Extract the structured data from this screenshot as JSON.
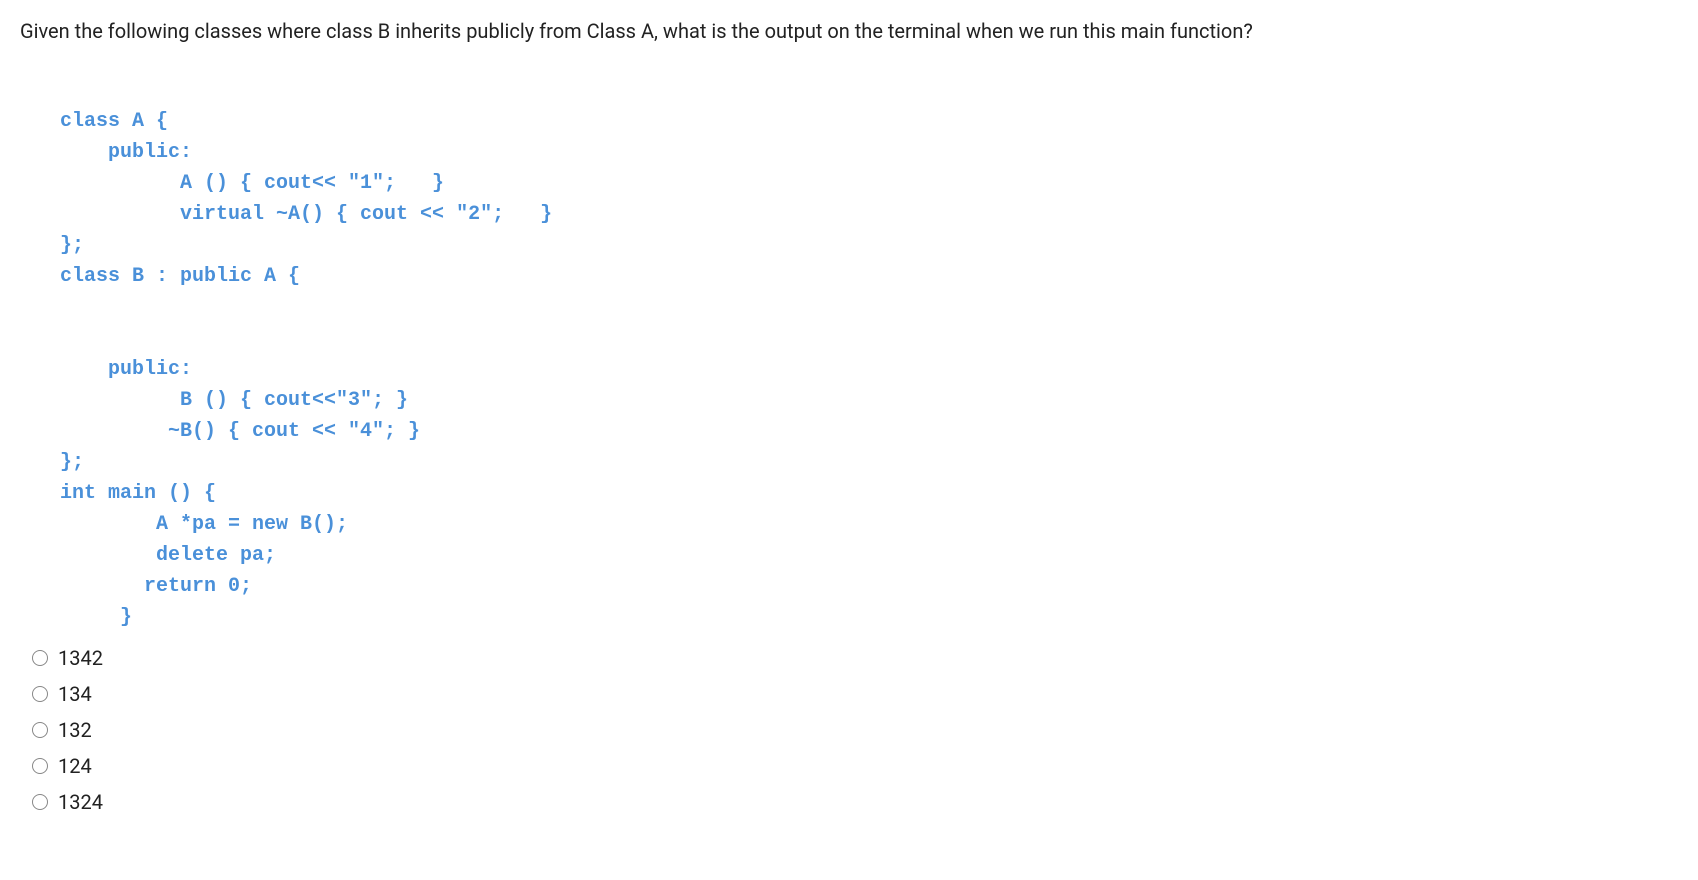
{
  "question": "Given the following classes where class B inherits publicly from Class A, what is the output on the terminal when we run this main function?",
  "code": "class A {\n    public:\n          A () { cout<< \"1\";   }\n          virtual ~A() { cout << \"2\";   }\n};\nclass B : public A {\n\n\n    public:\n          B () { cout<<\"3\"; }\n         ~B() { cout << \"4\"; }\n};\nint main () {\n        A *pa = new B();\n        delete pa;\n       return 0;\n     }",
  "options": [
    {
      "label": "1342"
    },
    {
      "label": "134"
    },
    {
      "label": "132"
    },
    {
      "label": "124"
    },
    {
      "label": "1324"
    }
  ]
}
